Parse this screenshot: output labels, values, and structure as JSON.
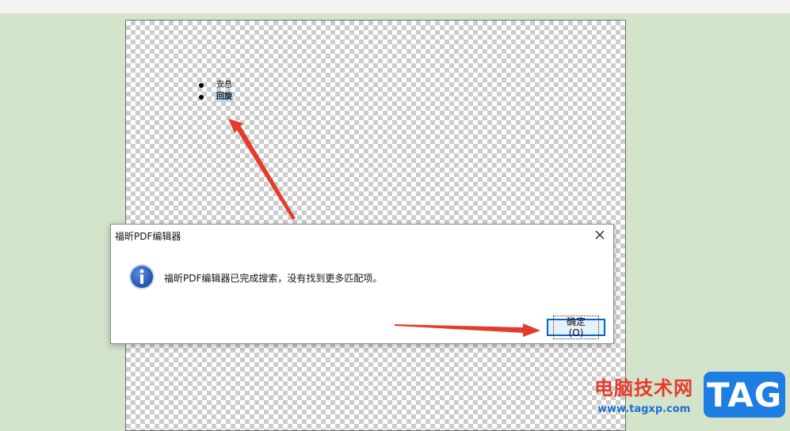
{
  "document": {
    "bullets": [
      {
        "text": "安息",
        "highlighted": false
      },
      {
        "text": "回旋",
        "highlighted": true
      }
    ]
  },
  "dialog": {
    "title": "福昕PDF编辑器",
    "message": "福昕PDF编辑器已完成搜索，没有找到更多匹配项。",
    "ok_label": "确定(O)",
    "icon": "info-icon",
    "close_icon": "close-icon"
  },
  "watermark": {
    "site_name": "电脑技术网",
    "url": "www.tagxp.com",
    "tag": "TAG"
  },
  "colors": {
    "background": "#d3e4cb",
    "accent_blue": "#0a64c8",
    "arrow_red": "#e53b2c"
  }
}
